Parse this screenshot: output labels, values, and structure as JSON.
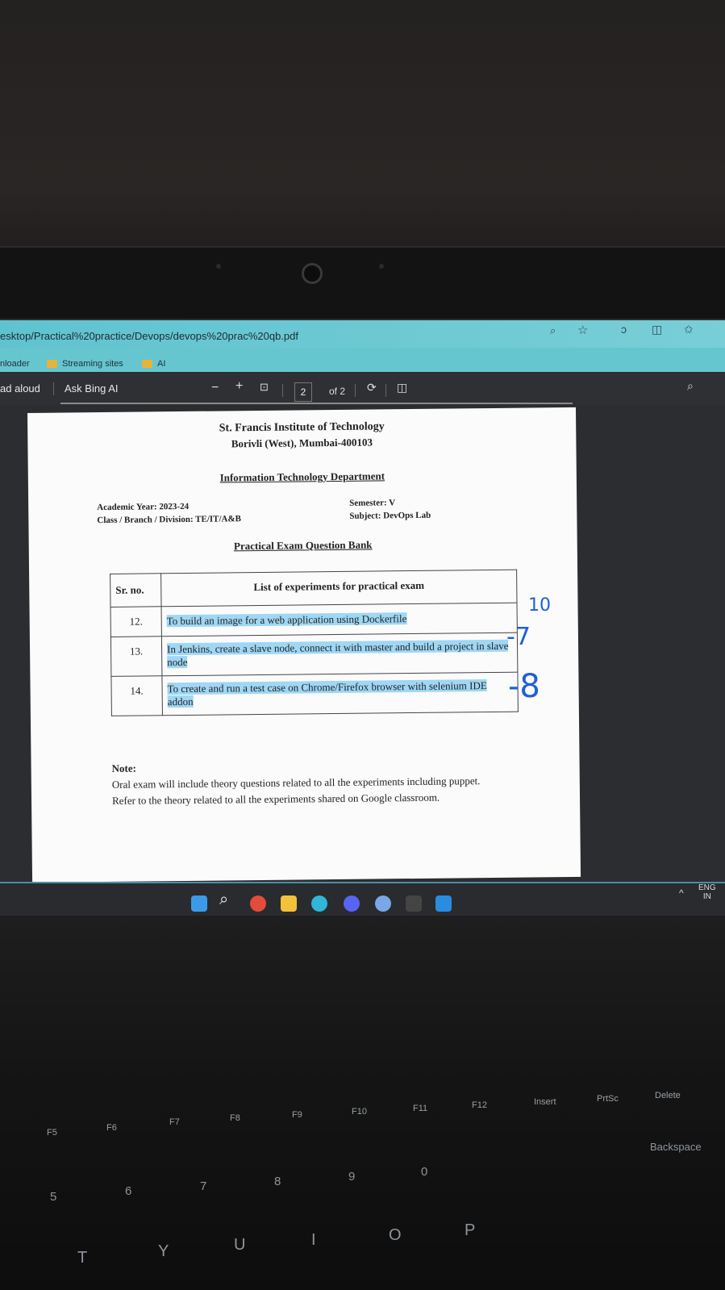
{
  "browser": {
    "address": "esktop/Practical%20practice/Devops/devops%20prac%20qb.pdf",
    "favorites": [
      "nloader",
      "Streaming sites",
      "AI"
    ],
    "toolbar": {
      "read_aloud": "ad aloud",
      "ask_bing": "Ask Bing AI",
      "zoom_out": "−",
      "zoom_in": "+",
      "page": "2",
      "of_pages": "of 2"
    }
  },
  "document": {
    "institute": "St. Francis Institute of Technology",
    "address": "Borivli (West), Mumbai-400103",
    "department": "Information Technology Department",
    "academic_year": "Academic Year: 2023-24",
    "class_branch": "Class / Branch / Division: TE/IT/A&B",
    "semester": "Semester: V",
    "subject": "Subject: DevOps Lab",
    "title": "Practical Exam Question Bank",
    "table": {
      "col1": "Sr. no.",
      "col2": "List of experiments for practical exam",
      "rows": [
        {
          "no": "12.",
          "text": "To build an image for a web application using Dockerfile"
        },
        {
          "no": "13.",
          "text": "In Jenkins, create a slave node, connect it with master and build a project in slave node"
        },
        {
          "no": "14.",
          "text": "To create and run a test case on Chrome/Firefox browser with selenium IDE addon"
        }
      ]
    },
    "note_label": "Note:",
    "note_text": "Oral exam will include theory questions related to all the experiments including puppet. Refer to the theory related to all the experiments shared on Google classroom."
  },
  "handwriting": [
    "10",
    "-7",
    "-8"
  ],
  "taskbar": {
    "lang": "ENG",
    "region": "IN"
  },
  "keyboard": {
    "fkeys": [
      "F5",
      "F6",
      "F7",
      "F8",
      "F9",
      "F10",
      "F11",
      "F12",
      "Insert",
      "PrtSc",
      "Delete"
    ],
    "numbers": [
      "5",
      "6",
      "7",
      "8",
      "9",
      "0"
    ],
    "letters": [
      "T",
      "Y",
      "U",
      "I",
      "O",
      "P"
    ],
    "backspace": "Backspace"
  },
  "colors": {
    "addressbar": "#66c6d0",
    "highlight": "#9fd7f5",
    "ink": "#1f5fd6"
  }
}
